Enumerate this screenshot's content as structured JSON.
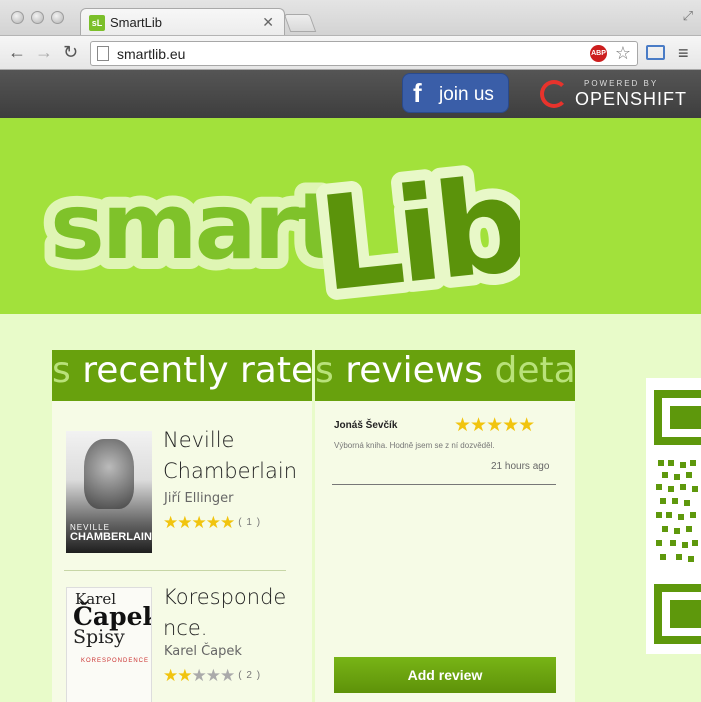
{
  "browser": {
    "tab_title": "SmartLib",
    "tab_favicon": "sL",
    "url": "smartlib.eu",
    "abp_label": "ABP"
  },
  "site": {
    "join_label": "join us",
    "facebook_letter": "f",
    "powered_by": "POWERED BY",
    "openshift": "OPENSHIFT",
    "logo_text": "smartLib"
  },
  "rated": {
    "ghost": "s",
    "heading": "recently rated",
    "books": [
      {
        "title": "Neville Chamberlain",
        "author": "Jiří Ellinger",
        "rating": 5,
        "count": "( 1 )",
        "cover_line1": "NEVILLE",
        "cover_line2": "CHAMBERLAIN"
      },
      {
        "title": "Koresponde nce.",
        "author": "Karel Čapek",
        "rating": 2,
        "count": "( 2 )",
        "cover_line1": "Karel",
        "cover_line2": "Čapek",
        "cover_line3": "Spisy",
        "cover_line4": "KORESPONDENCE"
      }
    ]
  },
  "reviews": {
    "ghost": "s",
    "heading": "reviews",
    "next_tab": "details",
    "items": [
      {
        "name": "Jonáš Ševčík",
        "rating": 5,
        "text": "Výborná kniha. Hodně jsem se z ní dozvěděl.",
        "time": "21 hours ago"
      }
    ],
    "add_label": "Add review"
  },
  "colors": {
    "hero": "#a2e13b",
    "panel_head": "#68a10d",
    "content_bg": "#e8fbc9",
    "star": "#f1c40f"
  }
}
